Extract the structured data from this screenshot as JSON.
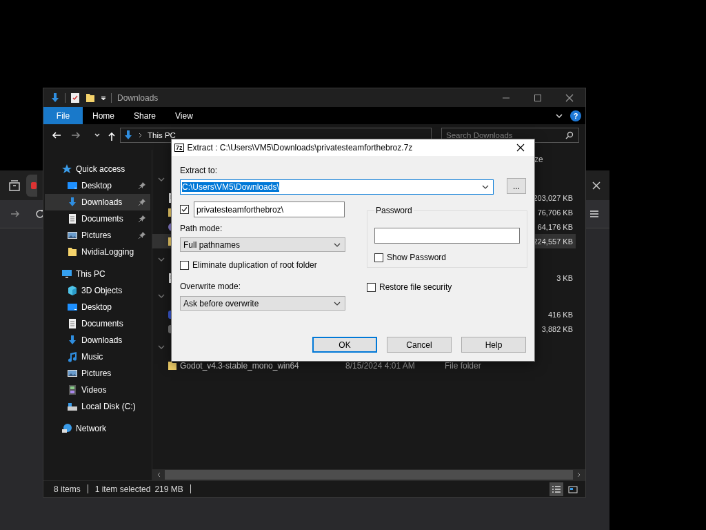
{
  "explorer": {
    "title": "Downloads",
    "ribbon": [
      {
        "label": "File",
        "kind": "menu"
      },
      {
        "label": "Home",
        "kind": "tab"
      },
      {
        "label": "Share",
        "kind": "tab"
      },
      {
        "label": "View",
        "kind": "tab"
      }
    ],
    "help": "?",
    "breadcrumb": [
      "This PC"
    ],
    "search": {
      "placeholder": "Search Downloads"
    },
    "sidebar": {
      "items": [
        {
          "label": "Quick access",
          "kind": "star",
          "pinned": false,
          "selected": false,
          "children": [
            {
              "label": "Desktop",
              "kind": "desktop",
              "pinned": true,
              "selected": false
            },
            {
              "label": "Downloads",
              "kind": "downloads",
              "pinned": true,
              "selected": true
            },
            {
              "label": "Documents",
              "kind": "documents",
              "pinned": true,
              "selected": false
            },
            {
              "label": "Pictures",
              "kind": "pictures",
              "pinned": true,
              "selected": false
            },
            {
              "label": "NvidiaLogging",
              "kind": "folder",
              "pinned": false,
              "selected": false
            }
          ]
        },
        {
          "label": "This PC",
          "kind": "pc",
          "pinned": false,
          "selected": false,
          "children": [
            {
              "label": "3D Objects",
              "kind": "cube",
              "pinned": false,
              "selected": false
            },
            {
              "label": "Desktop",
              "kind": "desktop",
              "pinned": false,
              "selected": false
            },
            {
              "label": "Documents",
              "kind": "documents",
              "pinned": false,
              "selected": false
            },
            {
              "label": "Downloads",
              "kind": "downloads",
              "pinned": false,
              "selected": false
            },
            {
              "label": "Music",
              "kind": "music",
              "pinned": false,
              "selected": false
            },
            {
              "label": "Pictures",
              "kind": "pictures",
              "pinned": false,
              "selected": false
            },
            {
              "label": "Videos",
              "kind": "videos",
              "pinned": false,
              "selected": false
            },
            {
              "label": "Local Disk (C:)",
              "kind": "disk",
              "pinned": false,
              "selected": false
            }
          ]
        },
        {
          "label": "Network",
          "kind": "network",
          "pinned": false,
          "selected": false
        }
      ]
    },
    "file_list": {
      "header": "ze",
      "rows": [
        {
          "kind": "group",
          "expanded": true
        },
        {
          "kind": "document",
          "size": "203,027 KB",
          "selected": false
        },
        {
          "kind": "folder",
          "size": "76,706 KB",
          "selected": false
        },
        {
          "kind": "disc",
          "size": "64,176 KB",
          "selected": false
        },
        {
          "kind": "folder",
          "size": "224,557 KB",
          "selected": true
        },
        {
          "kind": "group",
          "expanded": true
        },
        {
          "kind": "document",
          "size": "3 KB",
          "selected": false
        },
        {
          "kind": "group",
          "expanded": true
        },
        {
          "kind": "app",
          "size": "416 KB",
          "selected": false
        },
        {
          "kind": "tool",
          "size": "3,882 KB",
          "selected": false
        },
        {
          "kind": "group",
          "expanded": true
        },
        {
          "kind": "folder",
          "name": "Godot_v4.3-stable_mono_win64",
          "date": "8/15/2024 4:01 AM",
          "item_type": "File folder",
          "selected": false
        }
      ]
    },
    "status_bar": {
      "item_count": "8 items",
      "selection": "1 item selected",
      "selection_size": "219 MB",
      "views": [
        {
          "kind": "details",
          "selected": true
        },
        {
          "kind": "tiles",
          "selected": false
        }
      ]
    }
  },
  "dialog": {
    "title": "Extract : C:\\Users\\VM5\\Downloads\\privatesteamforthebroz.7z",
    "badge": "7z",
    "extract_to": {
      "label": "Extract to:",
      "value": "C:\\Users\\VM5\\Downloads\\",
      "text_selected": true
    },
    "browse": "...",
    "subfolder": {
      "checked": true,
      "value": "privatesteamforthebroz\\"
    },
    "path_mode": {
      "label": "Path mode:",
      "value": "Full pathnames"
    },
    "eliminate_root": {
      "label": "Eliminate duplication of root folder",
      "checked": false
    },
    "overwrite_mode": {
      "label": "Overwrite mode:",
      "value": "Ask before overwrite"
    },
    "password": {
      "label": "Password",
      "show_password": {
        "label": "Show Password",
        "checked": false
      }
    },
    "restore_security": {
      "label": "Restore file security",
      "checked": false
    },
    "buttons": [
      {
        "label": "OK",
        "default": true
      },
      {
        "label": "Cancel",
        "default": false
      },
      {
        "label": "Help",
        "default": false
      }
    ]
  }
}
